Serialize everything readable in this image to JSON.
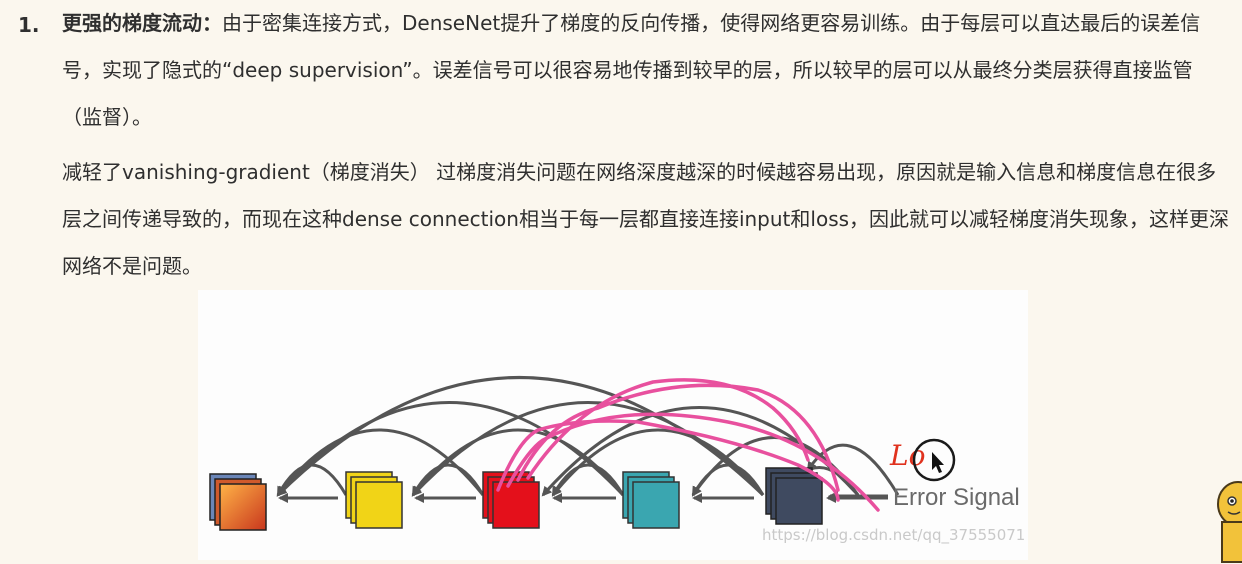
{
  "list": {
    "number": "1.",
    "strong_title": "更强的梯度流动：",
    "paragraph1": "由于密集连接方式，DenseNet提升了梯度的反向传播，使得网络更容易训练。由于每层可以直达最后的误差信号，实现了隐式的“deep supervision”。误差信号可以很容易地传播到较早的层，所以较早的层可以从最终分类层获得直接监管（监督）。",
    "paragraph2": "减轻了vanishing-gradient（梯度消失）   过梯度消失问题在网络深度越深的时候越容易出现，原因就是输入信息和梯度信息在很多层之间传递导致的，而现在这种dense  connection相当于每一层都直接连接input和loss，因此就可以减轻梯度消失现象，这样更深网络不是问题。"
  },
  "figure": {
    "error_label": "Error Signal",
    "handwriting": "Lo",
    "watermark": "https://blog.csdn.net/qq_37555071",
    "colors": {
      "arc": "#555555",
      "ink": "#e8509e",
      "handwriting": "#e0321e",
      "block1": "#e8732a",
      "block2": "#f1d417",
      "block3": "#e4101b",
      "block4": "#3aa6b0",
      "block5": "#3f4a60"
    }
  }
}
